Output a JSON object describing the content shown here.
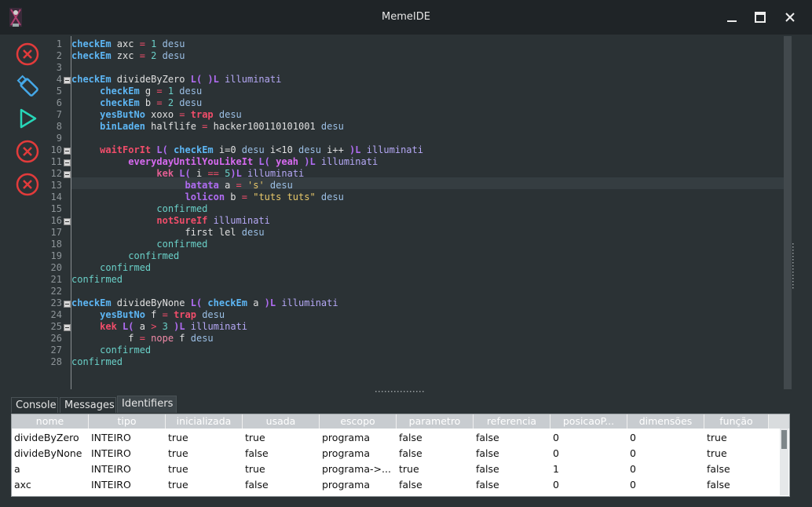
{
  "window": {
    "title": "MemeIDE",
    "icon": "meme-logo-icon"
  },
  "sidebar": [
    {
      "icon": "close-circle-icon",
      "color": "#e23b3b"
    },
    {
      "icon": "usb-icon",
      "color": "#45a8e8"
    },
    {
      "icon": "play-icon",
      "color": "#27d6b8"
    },
    {
      "icon": "close-circle-icon",
      "color": "#e23b3b"
    },
    {
      "icon": "close-circle-icon",
      "color": "#e23b3b"
    }
  ],
  "code": {
    "line_numbers": [
      "1",
      "2",
      "3",
      "4",
      "5",
      "6",
      "7",
      "8",
      "9",
      "10",
      "11",
      "12",
      "13",
      "14",
      "15",
      "16",
      "17",
      "18",
      "19",
      "20",
      "21",
      "22",
      "23",
      "24",
      "25",
      "26",
      "27",
      "28"
    ],
    "fold_lines": [
      4,
      10,
      11,
      12,
      16,
      23,
      25
    ],
    "lines": [
      [
        [
          "kw-blue",
          "checkEm"
        ],
        [
          "",
          " axc "
        ],
        [
          "op",
          "="
        ],
        [
          "num",
          " 1"
        ],
        [
          "desu",
          " desu"
        ]
      ],
      [
        [
          "kw-blue",
          "checkEm"
        ],
        [
          "",
          " zxc "
        ],
        [
          "op",
          "="
        ],
        [
          "num",
          " 2"
        ],
        [
          "desu",
          " desu"
        ]
      ],
      [],
      [
        [
          "kw-blue",
          "checkEm"
        ],
        [
          "",
          " divideByZero "
        ],
        [
          "kw-purple",
          "L( )L"
        ],
        [
          "kw-ital",
          " illuminati"
        ]
      ],
      [
        [
          "",
          "     "
        ],
        [
          "kw-blue",
          "checkEm"
        ],
        [
          "",
          " g "
        ],
        [
          "op",
          "="
        ],
        [
          "num",
          " 1"
        ],
        [
          "desu",
          " desu"
        ]
      ],
      [
        [
          "",
          "     "
        ],
        [
          "kw-blue",
          "checkEm"
        ],
        [
          "",
          " b "
        ],
        [
          "op",
          "="
        ],
        [
          "num",
          " 2"
        ],
        [
          "desu",
          " desu"
        ]
      ],
      [
        [
          "",
          "     "
        ],
        [
          "kw-blue",
          "yesButNo"
        ],
        [
          "",
          " xoxo "
        ],
        [
          "op",
          "="
        ],
        [
          "kw-red",
          " trap"
        ],
        [
          "desu",
          " desu"
        ]
      ],
      [
        [
          "",
          "     "
        ],
        [
          "kw-blue",
          "binLaden"
        ],
        [
          "",
          " halflife "
        ],
        [
          "op",
          "="
        ],
        [
          "",
          " hacker100110101001"
        ],
        [
          "desu",
          " desu"
        ]
      ],
      [],
      [
        [
          "",
          "     "
        ],
        [
          "kw-red",
          "waitForIt"
        ],
        [
          "kw-purple",
          " L("
        ],
        [
          "kw-blue",
          " checkEm"
        ],
        [
          "",
          " i=0"
        ],
        [
          "desu",
          " desu"
        ],
        [
          "",
          " i<10"
        ],
        [
          "desu",
          " desu"
        ],
        [
          "",
          " i++ "
        ],
        [
          "kw-purple",
          ")L"
        ],
        [
          "kw-ital",
          " illuminati"
        ]
      ],
      [
        [
          "",
          "          "
        ],
        [
          "kw-mag",
          "everydayUntilYouLikeIt"
        ],
        [
          "kw-purple",
          " L("
        ],
        [
          "kw-mag",
          " yeah"
        ],
        [
          "kw-purple",
          " )L"
        ],
        [
          "kw-ital",
          " illuminati"
        ]
      ],
      [
        [
          "",
          "               "
        ],
        [
          "kw-pink",
          "kek"
        ],
        [
          "kw-purple",
          " L("
        ],
        [
          "",
          " i "
        ],
        [
          "op",
          "=="
        ],
        [
          "num",
          " 5"
        ],
        [
          "kw-purple",
          ")L"
        ],
        [
          "kw-ital",
          " illuminati"
        ]
      ],
      [
        [
          "",
          "                    "
        ],
        [
          "kw-purple",
          "batata"
        ],
        [
          "",
          " a "
        ],
        [
          "op",
          "="
        ],
        [
          "str",
          " 's'"
        ],
        [
          "desu",
          " desu"
        ]
      ],
      [
        [
          "",
          "                    "
        ],
        [
          "kw-purple",
          "lolicon"
        ],
        [
          "",
          " b "
        ],
        [
          "op",
          "="
        ],
        [
          "str",
          " \"tuts tuts\""
        ],
        [
          "desu",
          " desu"
        ]
      ],
      [
        [
          "",
          "               "
        ],
        [
          "conf",
          "confirmed"
        ]
      ],
      [
        [
          "",
          "               "
        ],
        [
          "kw-red",
          "notSureIf"
        ],
        [
          "kw-ital",
          " illuminati"
        ]
      ],
      [
        [
          "",
          "                    first lel "
        ],
        [
          "desu",
          "desu"
        ]
      ],
      [
        [
          "",
          "               "
        ],
        [
          "conf",
          "confirmed"
        ]
      ],
      [
        [
          "",
          "          "
        ],
        [
          "conf",
          "confirmed"
        ]
      ],
      [
        [
          "",
          "     "
        ],
        [
          "conf",
          "confirmed"
        ]
      ],
      [
        [
          "conf",
          "confirmed"
        ]
      ],
      [],
      [
        [
          "kw-blue",
          "checkEm"
        ],
        [
          "",
          " divideByNone "
        ],
        [
          "kw-purple",
          "L("
        ],
        [
          "kw-blue",
          " checkEm"
        ],
        [
          "",
          " a "
        ],
        [
          "kw-purple",
          ")L"
        ],
        [
          "kw-ital",
          " illuminati"
        ]
      ],
      [
        [
          "",
          "     "
        ],
        [
          "kw-blue",
          "yesButNo"
        ],
        [
          "",
          " f "
        ],
        [
          "op",
          "="
        ],
        [
          "kw-red",
          " trap"
        ],
        [
          "desu",
          " desu"
        ]
      ],
      [
        [
          "",
          "     "
        ],
        [
          "kw-red",
          "kek"
        ],
        [
          "kw-purple",
          " L("
        ],
        [
          "",
          " a "
        ],
        [
          "op",
          ">"
        ],
        [
          "num",
          " 3"
        ],
        [
          "kw-purple",
          " )L"
        ],
        [
          "kw-ital",
          " illuminati"
        ]
      ],
      [
        [
          "",
          "          f "
        ],
        [
          "op",
          "="
        ],
        [
          "nope",
          " nope"
        ],
        [
          "",
          " f "
        ],
        [
          "desu",
          "desu"
        ]
      ],
      [
        [
          "",
          "     "
        ],
        [
          "conf",
          "confirmed"
        ]
      ],
      [
        [
          "conf",
          "confirmed"
        ]
      ]
    ]
  },
  "bottom_tabs": [
    {
      "label": "Console",
      "selected": false
    },
    {
      "label": "Messages",
      "selected": false
    },
    {
      "label": "Identifiers",
      "selected": true
    }
  ],
  "table": {
    "columns": [
      "nome",
      "tipo",
      "inicializada",
      "usada",
      "escopo",
      "parametro",
      "referencia",
      "posicaoP...",
      "dimensões",
      "função"
    ],
    "rows": [
      [
        "divideByZero",
        "INTEIRO",
        "true",
        "true",
        "programa",
        "false",
        "false",
        "0",
        "0",
        "true"
      ],
      [
        "divideByNone",
        "INTEIRO",
        "true",
        "false",
        "programa",
        "false",
        "false",
        "0",
        "0",
        "true"
      ],
      [
        "a",
        "INTEIRO",
        "true",
        "true",
        "programa->...",
        "true",
        "false",
        "1",
        "0",
        "false"
      ],
      [
        "axc",
        "INTEIRO",
        "true",
        "false",
        "programa",
        "false",
        "false",
        "0",
        "0",
        "false"
      ]
    ]
  }
}
